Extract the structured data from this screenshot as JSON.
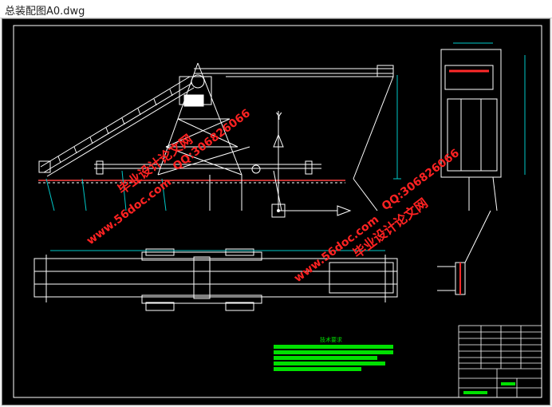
{
  "window": {
    "title": "总装配图A0.dwg"
  },
  "watermarks": [
    {
      "id": "wm-site-1",
      "text": "www.56doc.com"
    },
    {
      "id": "wm-qq-1",
      "text": "QQ:306826066"
    },
    {
      "id": "wm-name-1",
      "text": "毕业设计论文网"
    },
    {
      "id": "wm-site-2",
      "text": "www.56doc.com"
    },
    {
      "id": "wm-qq-2",
      "text": "QQ:306826066"
    },
    {
      "id": "wm-name-2",
      "text": "毕业设计论文网"
    }
  ],
  "drawing": {
    "axis_label_y": "Y",
    "notes_heading": "技术要求",
    "colors": {
      "frame": "#ffffff",
      "structure": "#ffffff",
      "dim": "#00c8c8",
      "accent": "#ff2a2a",
      "notes": "#00e000",
      "ground": "#c03030",
      "watermark": "#ff2222"
    }
  }
}
